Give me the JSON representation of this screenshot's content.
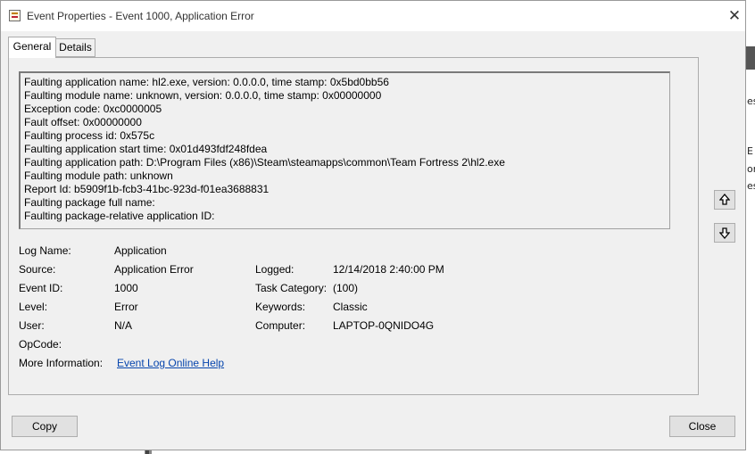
{
  "window": {
    "title": "Event Properties - Event 1000, Application Error",
    "close_glyph": "✕",
    "icon": "event-viewer-icon"
  },
  "tabs": [
    {
      "label": "General",
      "selected": true
    },
    {
      "label": "Details",
      "selected": false
    }
  ],
  "description": [
    "Faulting application name: hl2.exe, version: 0.0.0.0, time stamp: 0x5bd0bb56",
    "Faulting module name: unknown, version: 0.0.0.0, time stamp: 0x00000000",
    "Exception code: 0xc0000005",
    "Fault offset: 0x00000000",
    "Faulting process id: 0x575c",
    "Faulting application start time: 0x01d493fdf248fdea",
    "Faulting application path: D:\\Program Files (x86)\\Steam\\steamapps\\common\\Team Fortress 2\\hl2.exe",
    "Faulting module path: unknown",
    "Report Id: b5909f1b-fcb3-41bc-923d-f01ea3688831",
    "Faulting package full name: ",
    "Faulting package-relative application ID: "
  ],
  "fields": {
    "log_name": {
      "label": "Log Name:",
      "value": "Application"
    },
    "source": {
      "label": "Source:",
      "value": "Application Error"
    },
    "logged": {
      "label": "Logged:",
      "value": "12/14/2018 2:40:00 PM"
    },
    "event_id": {
      "label": "Event ID:",
      "value": "1000"
    },
    "task_category": {
      "label": "Task Category:",
      "value": "(100)"
    },
    "level": {
      "label": "Level:",
      "value": "Error"
    },
    "keywords": {
      "label": "Keywords:",
      "value": "Classic"
    },
    "user": {
      "label": "User:",
      "value": "N/A"
    },
    "computer": {
      "label": "Computer:",
      "value": "LAPTOP-0QNIDO4G"
    },
    "opcode": {
      "label": "OpCode:",
      "value": ""
    },
    "more_info": {
      "label": "More Information:",
      "link": "Event Log Online Help"
    }
  },
  "nav": {
    "up_icon": "arrow-up-icon",
    "down_icon": "arrow-down-icon"
  },
  "buttons": {
    "copy": "Copy",
    "close": "Close"
  },
  "background_fragments": [
    "es",
    "E",
    "or",
    "es"
  ]
}
